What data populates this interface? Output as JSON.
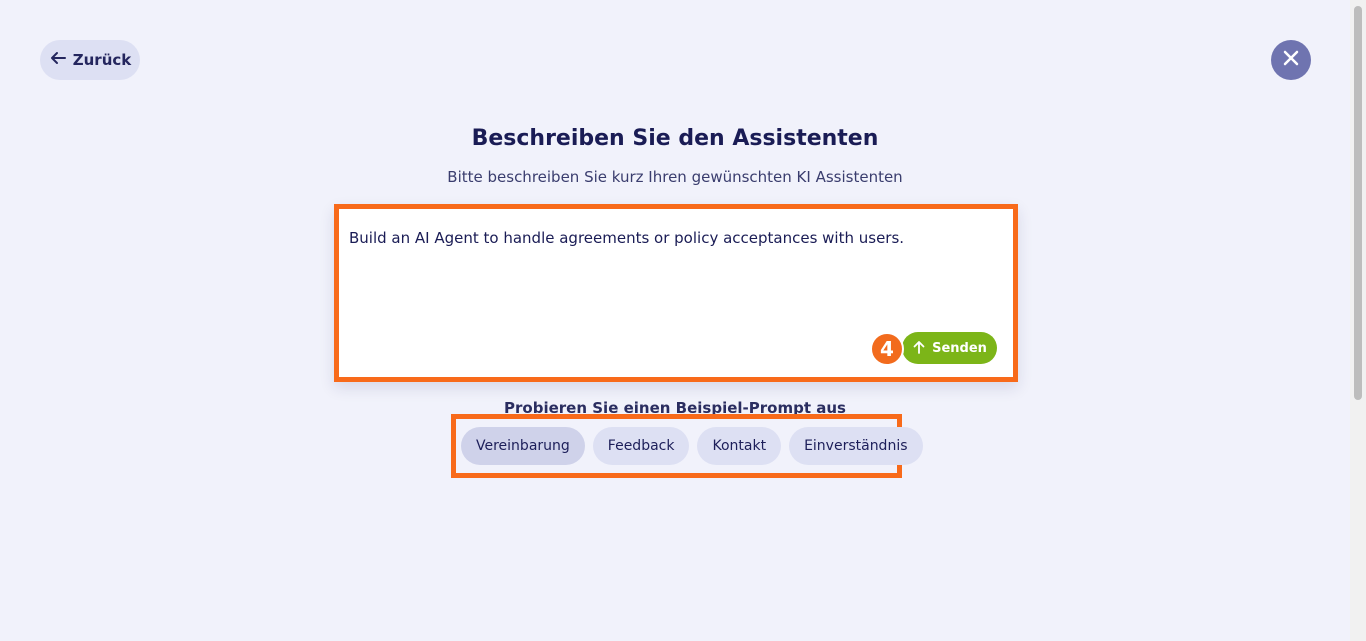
{
  "header": {
    "back_label": "Zurück",
    "back_icon": "arrow-left-icon",
    "close_icon": "close-icon"
  },
  "main": {
    "title": "Beschreiben Sie den Assistenten",
    "subtitle": "Bitte beschreiben Sie kurz Ihren gewünschten KI Assistenten",
    "prompt_value": "Build an AI Agent to handle agreements or policy acceptances with users.",
    "step_badge": "4",
    "send_label": "Senden",
    "send_icon": "arrow-up-icon"
  },
  "examples": {
    "heading": "Probieren Sie einen Beispiel-Prompt aus",
    "chips": [
      {
        "label": "Vereinbarung",
        "active": true
      },
      {
        "label": "Feedback",
        "active": false
      },
      {
        "label": "Kontakt",
        "active": false
      },
      {
        "label": "Einverständnis",
        "active": false
      }
    ]
  },
  "colors": {
    "background": "#f1f2fb",
    "accent_send": "#7cb518",
    "highlight_frame": "#f86a1a",
    "close_button": "#6f74b0"
  }
}
